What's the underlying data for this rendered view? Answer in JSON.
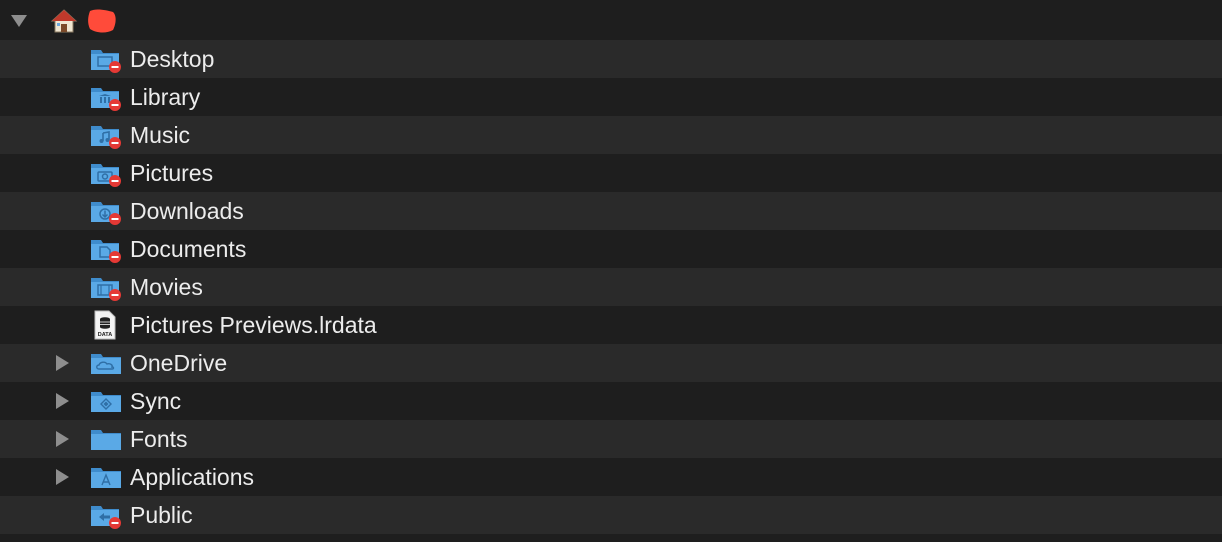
{
  "root": {
    "name": "",
    "icon": "home-icon",
    "expanded": true
  },
  "items": [
    {
      "label": "Desktop",
      "icon": "desktop-folder-icon",
      "badge": "no-access-badge",
      "expandable": false
    },
    {
      "label": "Library",
      "icon": "library-folder-icon",
      "badge": "no-access-badge",
      "expandable": false
    },
    {
      "label": "Music",
      "icon": "music-folder-icon",
      "badge": "no-access-badge",
      "expandable": false
    },
    {
      "label": "Pictures",
      "icon": "pictures-folder-icon",
      "badge": "no-access-badge",
      "expandable": false
    },
    {
      "label": "Downloads",
      "icon": "downloads-folder-icon",
      "badge": "no-access-badge",
      "expandable": false
    },
    {
      "label": "Documents",
      "icon": "documents-folder-icon",
      "badge": "no-access-badge",
      "expandable": false
    },
    {
      "label": "Movies",
      "icon": "movies-folder-icon",
      "badge": "no-access-badge",
      "expandable": false
    },
    {
      "label": "Pictures Previews.lrdata",
      "icon": "data-file-icon",
      "badge": null,
      "expandable": false
    },
    {
      "label": "OneDrive",
      "icon": "cloud-folder-icon",
      "badge": null,
      "expandable": true
    },
    {
      "label": "Sync",
      "icon": "sync-folder-icon",
      "badge": null,
      "expandable": true
    },
    {
      "label": "Fonts",
      "icon": "folder-icon",
      "badge": null,
      "expandable": true
    },
    {
      "label": "Applications",
      "icon": "applications-folder-icon",
      "badge": null,
      "expandable": true
    },
    {
      "label": "Public",
      "icon": "public-folder-icon",
      "badge": "no-access-badge",
      "expandable": false
    }
  ],
  "colors": {
    "background": "#1e1e1e",
    "row_alt": "#2a2a2a",
    "text": "#ececec",
    "folder": "#5aa9e6",
    "folder_dark": "#3f8ccc",
    "badge": "#e53935",
    "redaction": "#ff4b3a",
    "disclosure": "#8e8e8e"
  }
}
